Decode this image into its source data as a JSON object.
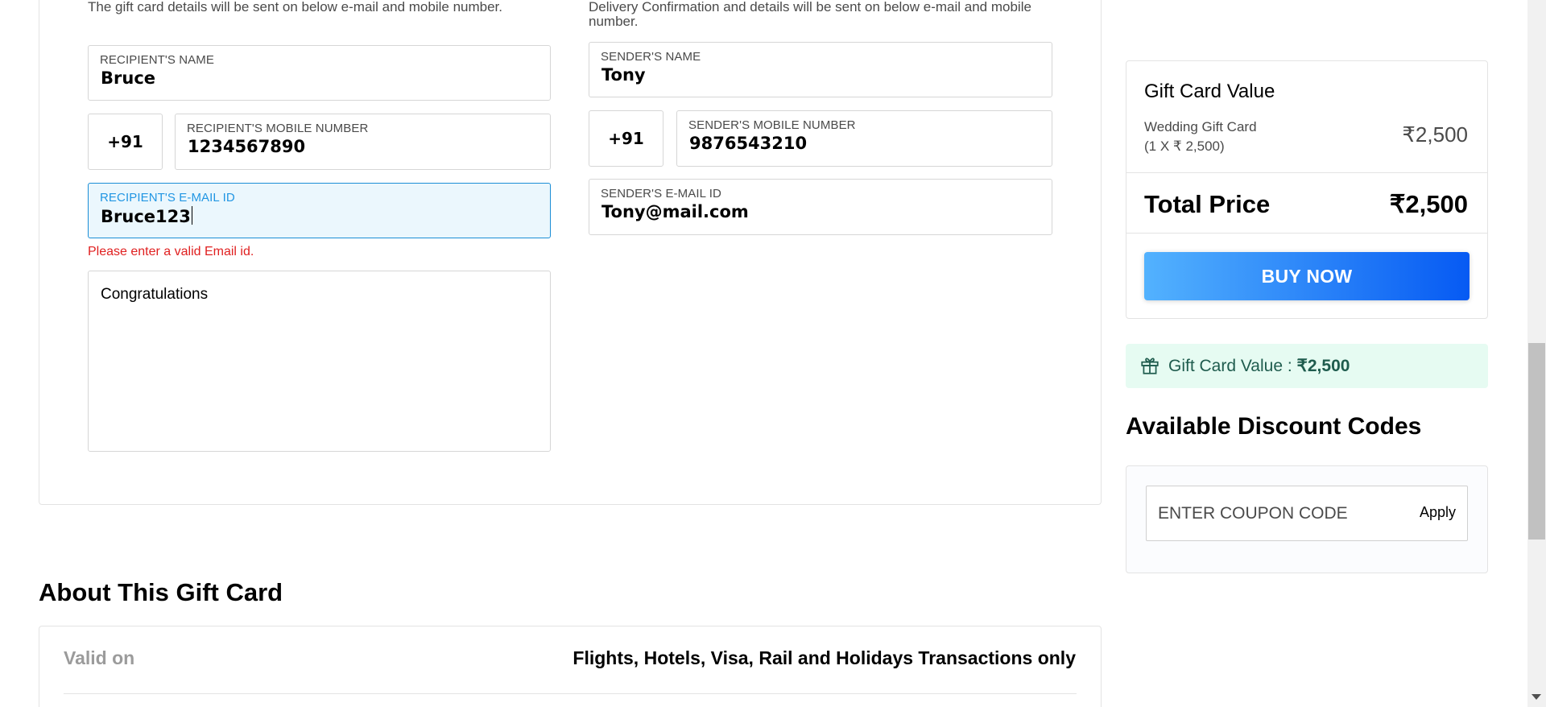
{
  "recipient": {
    "note": "The gift card details will be sent on below e-mail and mobile number.",
    "name_label": "RECIPIENT'S NAME",
    "name_value": "Bruce",
    "country_code": "+91",
    "mobile_label": "RECIPIENT'S MOBILE NUMBER",
    "mobile_value": "1234567890",
    "email_label": "RECIPIENT'S E-MAIL ID",
    "email_value": "Bruce123",
    "email_error": "Please enter a valid Email id.",
    "message": "Congratulations"
  },
  "sender": {
    "note": "Delivery Confirmation and details will be sent on below e-mail and mobile number.",
    "name_label": "SENDER'S NAME",
    "name_value": "Tony",
    "country_code": "+91",
    "mobile_label": "SENDER'S MOBILE NUMBER",
    "mobile_value": "9876543210",
    "email_label": "SENDER'S E-MAIL ID",
    "email_value": "Tony@mail.com"
  },
  "summary": {
    "title": "Gift Card Value",
    "item_name": "Wedding Gift Card",
    "item_qty": "(1 X ₹ 2,500)",
    "item_price": "₹2,500",
    "total_label": "Total Price",
    "total_value": "₹2,500",
    "buy_label": "BUY NOW"
  },
  "gift_value_banner": {
    "icon": "gift-icon",
    "label": "Gift Card Value : ",
    "value": "₹2,500"
  },
  "discount": {
    "title": "Available Discount Codes",
    "coupon_placeholder": "ENTER COUPON CODE",
    "apply_label": "Apply"
  },
  "about": {
    "title": "About This Gift Card",
    "valid_label": "Valid on",
    "valid_value": "Flights, Hotels, Visa, Rail and Holidays Transactions only"
  },
  "colors": {
    "accent": "#2196e3",
    "error": "#e02020",
    "buy_gradient_start": "#53b2fe",
    "buy_gradient_end": "#065af3",
    "banner_bg": "#e6fbf2"
  }
}
